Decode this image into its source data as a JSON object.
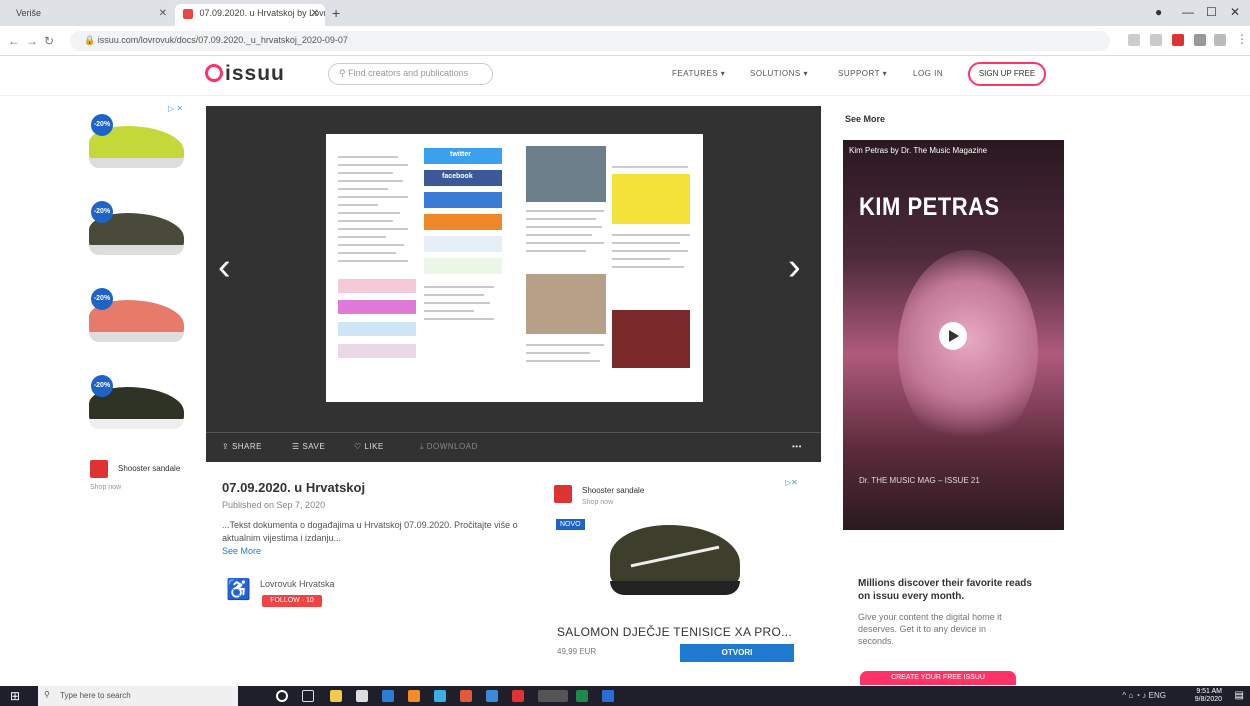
{
  "browser": {
    "tabs": [
      {
        "label": "Veriše",
        "active": false
      },
      {
        "label": "07.09.2020. u Hrvatskoj by Lovr...",
        "active": true
      }
    ],
    "new_tab": "+",
    "window_controls": {
      "minimize": "—",
      "maximize": "☐",
      "close": "✕"
    },
    "nav": {
      "back": "←",
      "forward": "→",
      "reload": "↻"
    },
    "url": "issuu.com/lovrovuk/docs/07.09.2020._u_hrvatskoj_2020-09-07"
  },
  "site": {
    "logo": "issuu",
    "search_placeholder": "Find creators and publications",
    "nav": [
      "FEATURES ▾",
      "SOLUTIONS ▾",
      "SUPPORT ▾",
      "LOG IN"
    ],
    "signup": "SIGN UP FREE"
  },
  "left_ads": {
    "badge": "-20%",
    "adchoices": "▷ ✕",
    "shop_name": "Shooster sandale",
    "shop_sub": "Shop now",
    "colors": [
      "#c4d83a",
      "#4a4a3a",
      "#e87a6a",
      "#2e3326"
    ]
  },
  "reader": {
    "prev": "‹",
    "next": "›",
    "actions": [
      "SHARE",
      "SAVE",
      "LIKE",
      "DOWNLOAD"
    ],
    "more": "•••",
    "page_content": {
      "twitter": "twitter",
      "facebook": "facebook"
    }
  },
  "document": {
    "title": "07.09.2020. u Hrvatskoj",
    "published": "Published on Sep 7, 2020",
    "description": "...Tekst dokumenta o događajima u Hrvatskoj 07.09.2020. Pročitajte više o aktualnim vijestima i izdanju...",
    "see_more": "See More",
    "publisher": "Lovrovuk Hrvatska",
    "follow": "FOLLOW · 10"
  },
  "mid_ad": {
    "shop_name": "Shooster sandale",
    "shop_sub": "Shop now",
    "adchoices": "▷✕",
    "tag": "NOVO",
    "title": "SALOMON DJEČJE TENISICE XA PRO...",
    "price": "49,99 EUR",
    "cta": "OTVORI"
  },
  "right": {
    "see_more": "See More",
    "video_title": "Kim Petras by Dr. The Music Magazine",
    "video_big": "KIM PETRAS",
    "video_caption": "Dr. THE MUSIC MAG – ISSUE 21",
    "promo_heading": "Millions discover their favorite reads on issuu every month.",
    "promo_text": "Give your content the digital home it deserves. Get it to any device in seconds.",
    "promo_button": "CREATE YOUR FREE ISSUU"
  },
  "taskbar": {
    "search": "Type here to search",
    "time": "9:51 AM",
    "date": "9/8/2020"
  }
}
